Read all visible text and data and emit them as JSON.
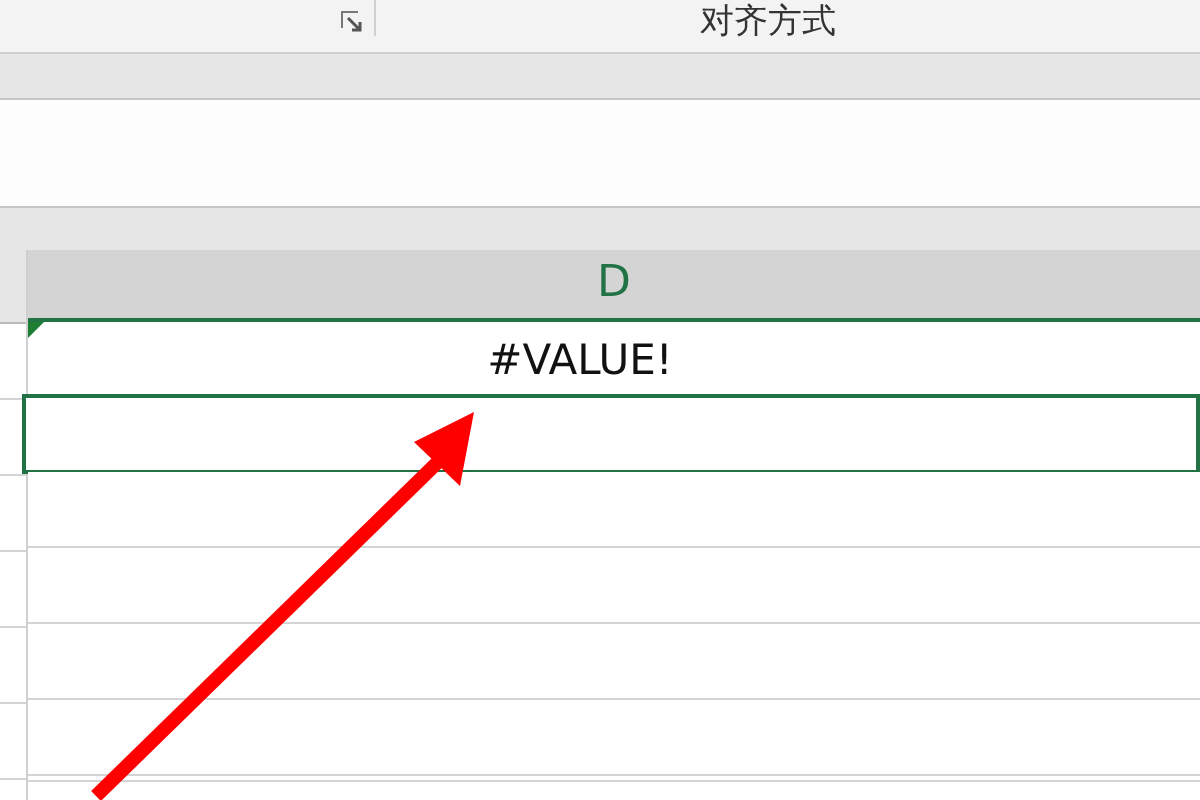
{
  "ribbon": {
    "group_label": "对齐方式"
  },
  "column_header": "D",
  "rows": [
    {
      "value": "#VALUE!",
      "error": true,
      "selected": false
    },
    {
      "value": "",
      "error": false,
      "selected": true
    },
    {
      "value": "",
      "error": false,
      "selected": false
    },
    {
      "value": "",
      "error": false,
      "selected": false
    },
    {
      "value": "",
      "error": false,
      "selected": false
    },
    {
      "value": "",
      "error": false,
      "selected": false
    }
  ]
}
